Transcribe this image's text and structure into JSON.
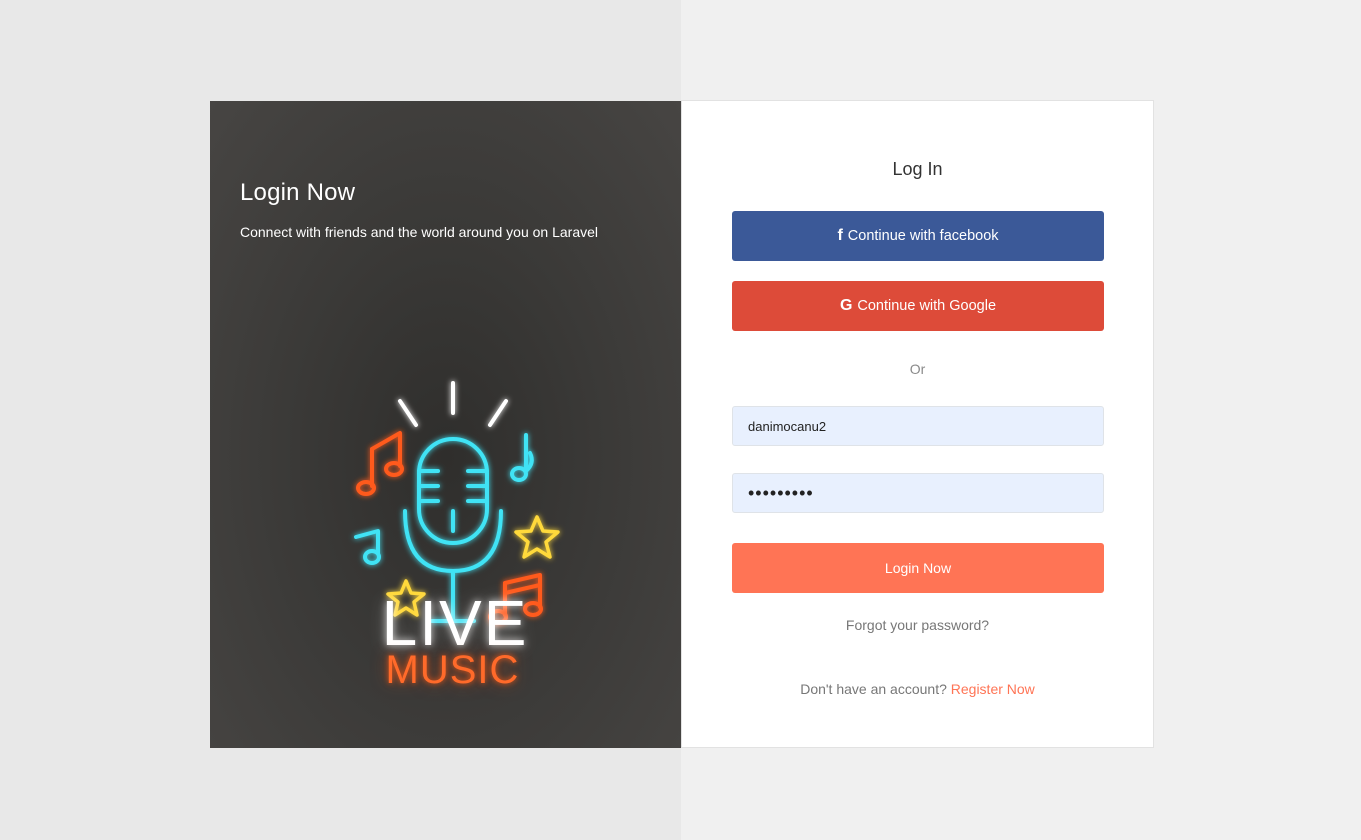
{
  "left_panel": {
    "title": "Login Now",
    "subtitle": "Connect with friends and the world around you on Laravel",
    "illustration": {
      "icon": "neon-microphone-icon",
      "line1": "LIVE",
      "line2": "MUSIC",
      "colors": {
        "cyan": "#3fe3f5",
        "orange": "#ff5a1f",
        "yellow": "#ffd93a",
        "white": "#ffffff"
      }
    }
  },
  "form": {
    "title": "Log In",
    "facebook_label": "Continue with facebook",
    "facebook_icon": "facebook-icon",
    "google_label": "Continue with Google",
    "google_icon": "google-icon",
    "divider_text": "Or",
    "username_value": "danimocanu2",
    "password_value": "•••••••••",
    "login_label": "Login Now",
    "forgot_label": "Forgot your password?",
    "register_prompt": "Don't have an account?",
    "register_link": "Register Now"
  },
  "colors": {
    "facebook": "#3b5998",
    "google": "#dd4b39",
    "accent": "#ff7455",
    "input_bg": "#e8f0fe"
  }
}
